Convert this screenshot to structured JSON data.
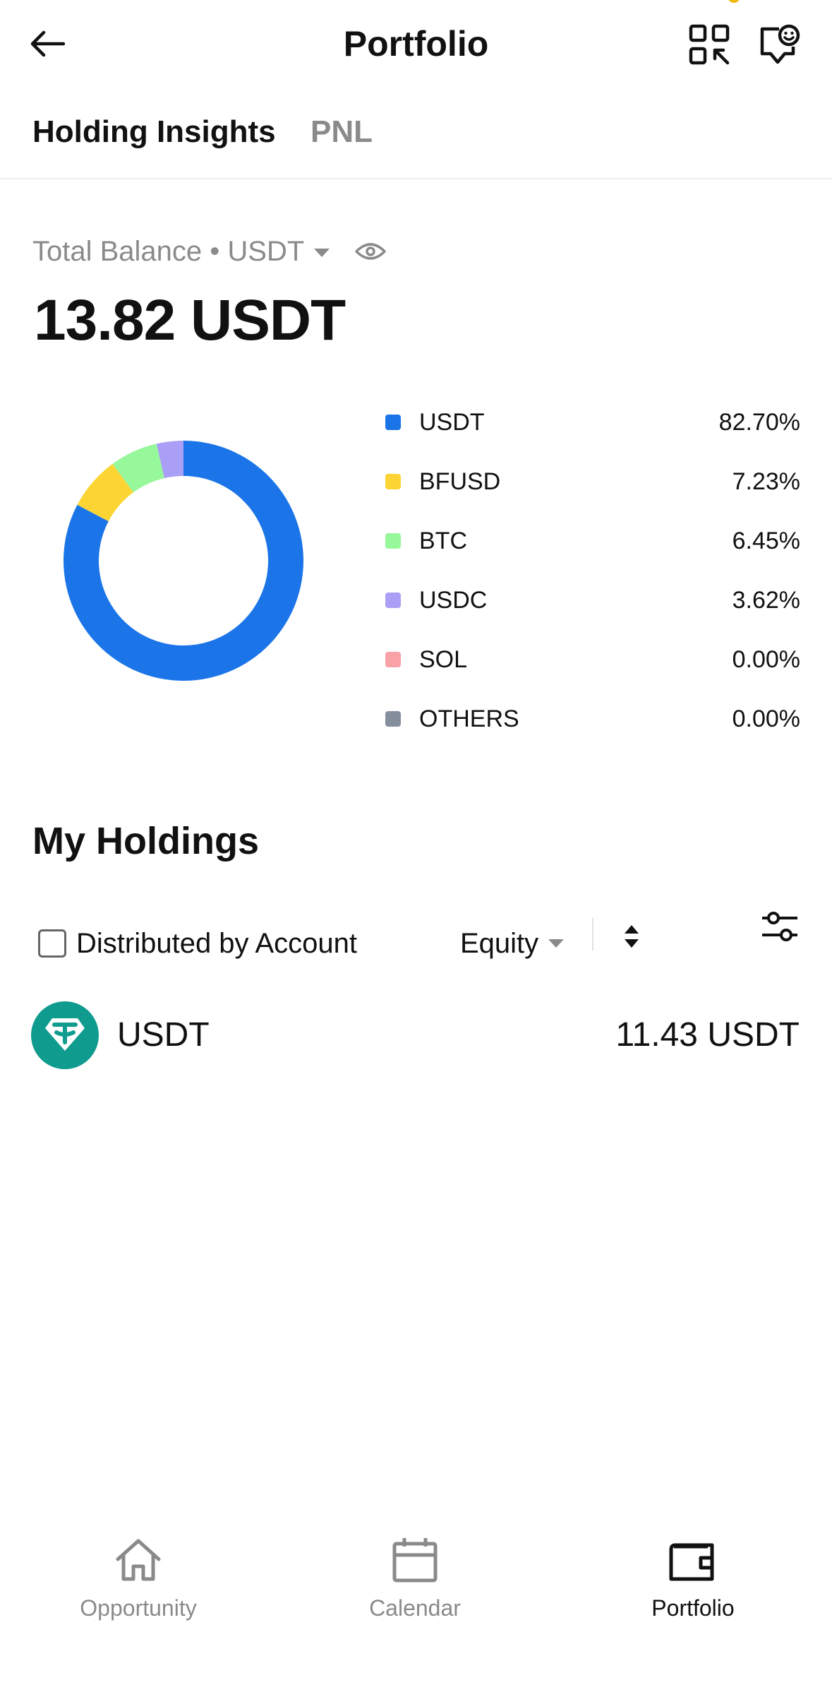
{
  "header": {
    "title": "Portfolio",
    "icons": {
      "back": "arrow-left-icon",
      "scan": "qr-scan-icon",
      "support": "chat-smile-icon"
    }
  },
  "tabs": [
    {
      "label": "Holding Insights",
      "active": true
    },
    {
      "label": "PNL",
      "active": false
    }
  ],
  "balance": {
    "label": "Total Balance • USDT",
    "value": "13.82 USDT"
  },
  "allocation": {
    "items": [
      {
        "name": "USDT",
        "percent_label": "82.70%",
        "percent": 82.7,
        "color": "#1b75e8"
      },
      {
        "name": "BFUSD",
        "percent_label": "7.23%",
        "percent": 7.23,
        "color": "#fcd535"
      },
      {
        "name": "BTC",
        "percent_label": "6.45%",
        "percent": 6.45,
        "color": "#97f89b"
      },
      {
        "name": "USDC",
        "percent_label": "3.62%",
        "percent": 3.62,
        "color": "#a99ff7"
      },
      {
        "name": "SOL",
        "percent_label": "0.00%",
        "percent": 0,
        "color": "#f9a1a7"
      },
      {
        "name": "OTHERS",
        "percent_label": "0.00%",
        "percent": 0,
        "color": "#848e9c"
      }
    ]
  },
  "holdings": {
    "title": "My Holdings",
    "distributed_label": "Distributed by Account",
    "distributed_checked": false,
    "sort_by": "Equity",
    "rows": [
      {
        "asset": "USDT",
        "value": "11.43 USDT",
        "logo_color": "#0f9b8e"
      }
    ]
  },
  "bottom_nav": [
    {
      "label": "Opportunity",
      "icon": "home-icon",
      "active": false
    },
    {
      "label": "Calendar",
      "icon": "calendar-icon",
      "active": false
    },
    {
      "label": "Portfolio",
      "icon": "wallet-icon",
      "active": true
    }
  ]
}
